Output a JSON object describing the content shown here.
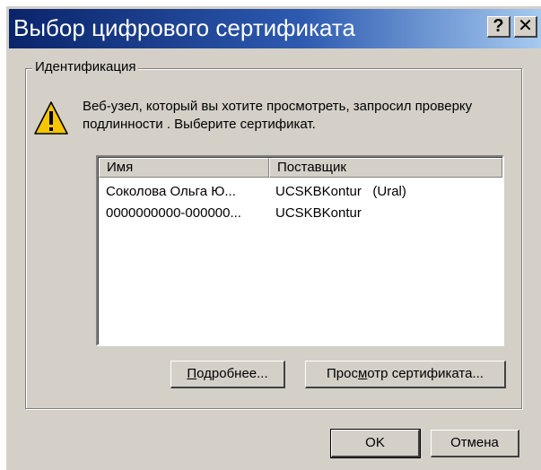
{
  "window": {
    "title": "Выбор цифрового сертификата",
    "help_label": "?",
    "close_label": "✕"
  },
  "identification": {
    "legend": "Идентификация",
    "message": "Веб-узел, который вы хотите просмотреть, запросил проверку подлинности . Выберите сертификат."
  },
  "certificates": {
    "columns": [
      "Имя",
      "Поставщик"
    ],
    "rows": [
      {
        "name": "Соколова Ольга Ю...",
        "issuer": "UCSKBKontur   (Ural)"
      },
      {
        "name": "0000000000-000000...",
        "issuer": "UCSKBKontur"
      }
    ]
  },
  "buttons": {
    "details": {
      "prefix": "",
      "mnemonic": "П",
      "rest": "одробнее..."
    },
    "view_cert": {
      "prefix": "Прос",
      "mnemonic": "м",
      "rest": "отр сертификата..."
    },
    "ok": "OK",
    "cancel": "Отмена"
  },
  "colors": {
    "title_gradient_start": "#0a246a",
    "title_gradient_end": "#a6caf0",
    "dialog_face": "#d4d0c8",
    "warning_yellow": "#f7c600"
  },
  "icons": {
    "warning": "warning-icon"
  }
}
